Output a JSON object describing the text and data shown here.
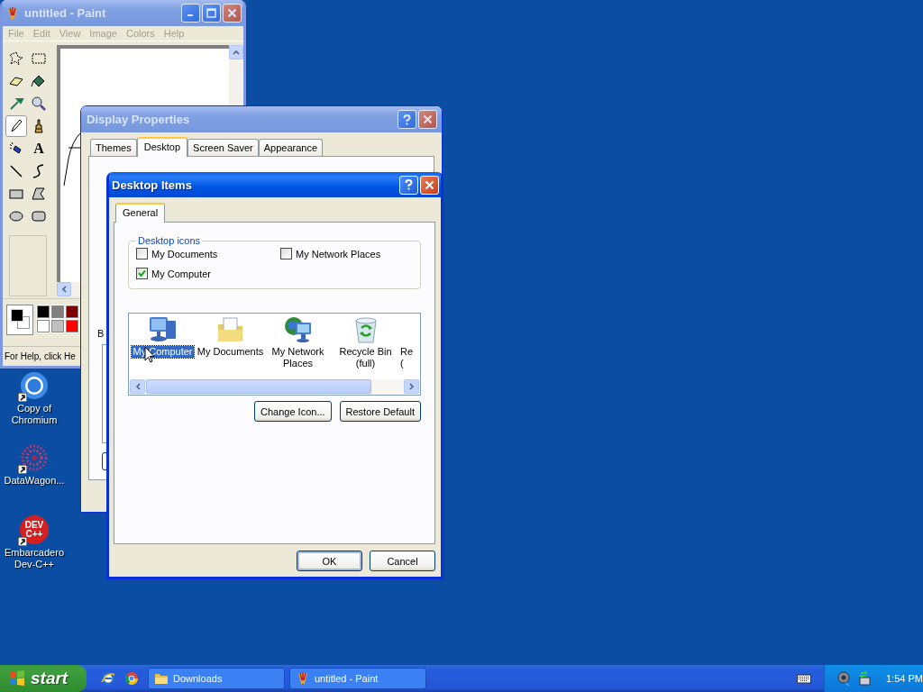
{
  "desktop_icons": [
    {
      "label": "Copy of Chromium",
      "kind": "chromium"
    },
    {
      "label": "DataWagon...",
      "kind": "datawagon"
    },
    {
      "label": "Embarcadero Dev-C++",
      "kind": "devcpp",
      "logo_lines": [
        "DEV",
        "C++"
      ]
    }
  ],
  "paint_window": {
    "title": "untitled - Paint",
    "active": false,
    "menu": [
      "File",
      "Edit",
      "View",
      "Image",
      "Colors",
      "Help"
    ],
    "tools": [
      {
        "kind": "free-select",
        "selected": false
      },
      {
        "kind": "rect-select",
        "selected": false
      },
      {
        "kind": "eraser",
        "selected": false
      },
      {
        "kind": "fill",
        "selected": false
      },
      {
        "kind": "picker",
        "selected": false
      },
      {
        "kind": "magnifier",
        "selected": false
      },
      {
        "kind": "pencil",
        "selected": true
      },
      {
        "kind": "brush",
        "selected": false
      },
      {
        "kind": "airbrush",
        "selected": false
      },
      {
        "kind": "text",
        "selected": false,
        "glyph": "A"
      },
      {
        "kind": "line",
        "selected": false
      },
      {
        "kind": "curve",
        "selected": false
      },
      {
        "kind": "rectangle",
        "selected": false
      },
      {
        "kind": "polygon",
        "selected": false
      },
      {
        "kind": "ellipse",
        "selected": false
      },
      {
        "kind": "rounded-rect",
        "selected": false
      }
    ],
    "palette": [
      {
        "color": "#000000"
      },
      {
        "color": "#808080"
      },
      {
        "color": "#800000"
      },
      {
        "color": "#ffffff"
      },
      {
        "color": "#c0c0c0"
      },
      {
        "color": "#ff0000"
      }
    ],
    "status": "For Help, click He"
  },
  "display_properties": {
    "title": "Display Properties",
    "active": false,
    "tabs": [
      {
        "label": "Themes",
        "selected": false
      },
      {
        "label": "Desktop",
        "selected": true
      },
      {
        "label": "Screen Saver",
        "selected": false
      },
      {
        "label": "Appearance",
        "selected": false
      }
    ],
    "label_fragment": "B"
  },
  "desktop_items": {
    "title": "Desktop Items",
    "active": true,
    "tabs": [
      {
        "label": "General",
        "selected": true
      }
    ],
    "group_title": "Desktop icons",
    "checkboxes": [
      {
        "label": "My Documents",
        "checked": false
      },
      {
        "label": "My Network Places",
        "checked": false
      },
      {
        "label": "My Computer",
        "checked": true
      }
    ],
    "icons": [
      {
        "kind": "computer",
        "label_lines": [
          "My Computer"
        ],
        "selected": true
      },
      {
        "kind": "documents",
        "label_lines": [
          "My Documents"
        ],
        "selected": false
      },
      {
        "kind": "network",
        "label_lines": [
          "My Network",
          "Places"
        ],
        "selected": false
      },
      {
        "kind": "recycle",
        "label_lines": [
          "Recycle Bin",
          "(full)"
        ],
        "selected": false
      },
      {
        "kind": "cut",
        "label_lines": [
          "Re",
          "("
        ],
        "selected": false
      }
    ],
    "buttons": [
      {
        "label": "Change Icon...",
        "kind": "action",
        "default": false
      },
      {
        "label": "Restore Default",
        "kind": "action",
        "default": false
      },
      {
        "label": "OK",
        "kind": "dialog",
        "default": true
      },
      {
        "label": "Cancel",
        "kind": "dialog",
        "default": false
      }
    ]
  },
  "taskbar": {
    "start": "start",
    "quick_launch": [
      {
        "kind": "ie"
      },
      {
        "kind": "chrome"
      }
    ],
    "tasks": [
      {
        "label": "Downloads",
        "kind": "folder",
        "selected": false
      },
      {
        "label": "untitled - Paint",
        "kind": "paint",
        "selected": false
      }
    ],
    "clock": "1:54 PM"
  }
}
